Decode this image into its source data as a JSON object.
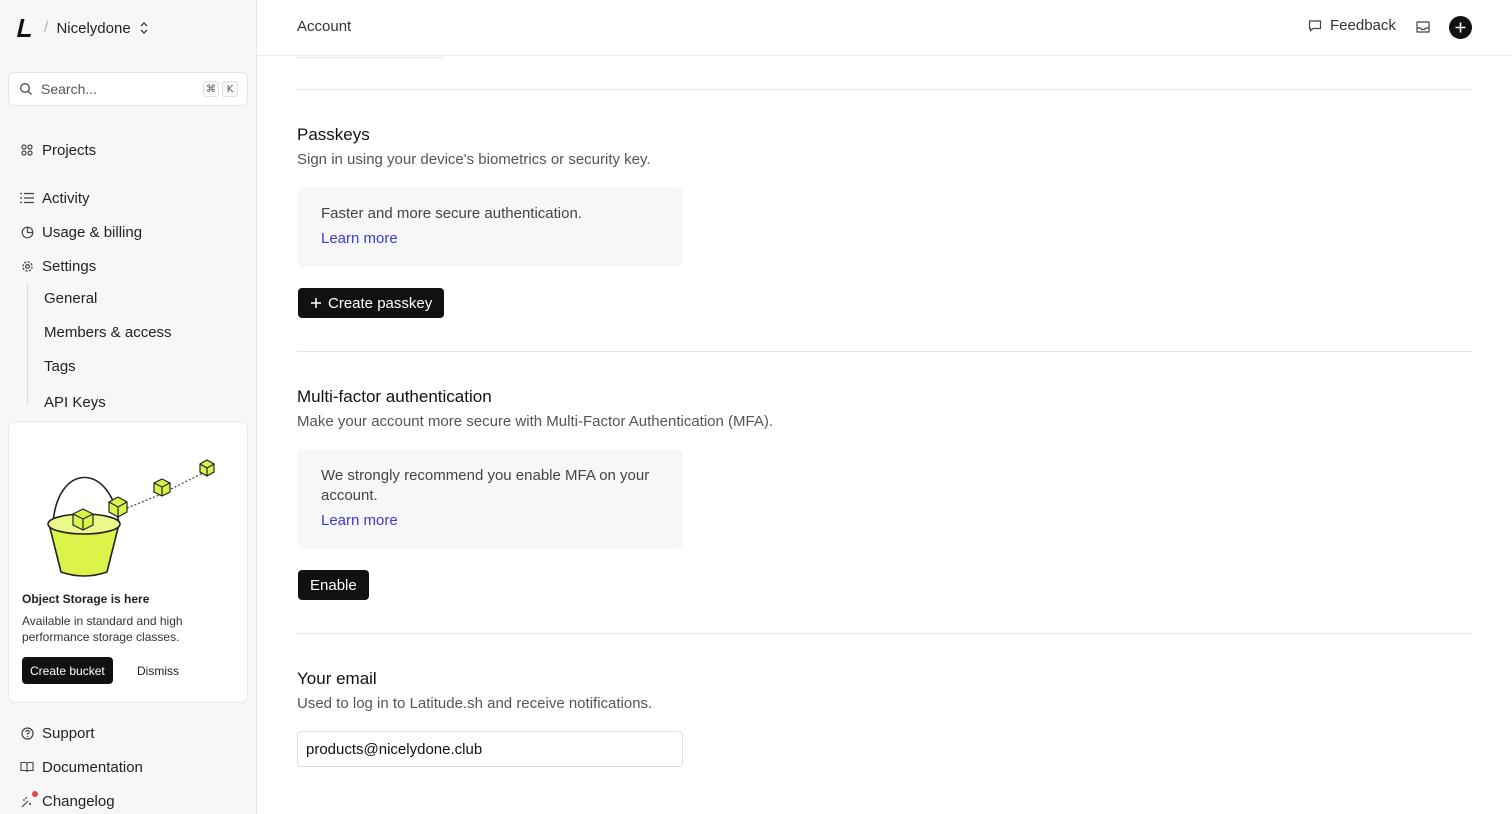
{
  "org": {
    "name": "Nicelydone"
  },
  "search": {
    "placeholder": "Search...",
    "shortcut_mod": "⌘",
    "shortcut_key": "K"
  },
  "nav": {
    "projects": "Projects",
    "activity": "Activity",
    "billing": "Usage & billing",
    "settings": "Settings",
    "settings_children": [
      "General",
      "Members & access",
      "Tags",
      "API Keys"
    ],
    "support": "Support",
    "documentation": "Documentation",
    "changelog": "Changelog"
  },
  "promo": {
    "title": "Object Storage is here",
    "text": "Available in standard and high performance storage classes.",
    "primary": "Create bucket",
    "secondary": "Dismiss"
  },
  "header": {
    "title": "Account",
    "feedback": "Feedback"
  },
  "passkeys": {
    "title": "Passkeys",
    "description": "Sign in using your device's biometrics or security key.",
    "info": "Faster and more secure authentication.",
    "learn_more": "Learn more",
    "button": "Create passkey"
  },
  "mfa": {
    "title": "Multi-factor authentication",
    "description": "Make your account more secure with Multi-Factor Authentication (MFA).",
    "info": "We strongly recommend you enable MFA on your account.",
    "learn_more": "Learn more",
    "button": "Enable"
  },
  "email": {
    "title": "Your email",
    "description": "Used to log in to Latitude.sh and receive notifications.",
    "value": "products@nicelydone.club"
  },
  "colors": {
    "accent_link": "#3b3bd6",
    "primary_button": "#111111",
    "promo_bucket": "#dcf34a",
    "notification_dot": "#e5484d"
  }
}
